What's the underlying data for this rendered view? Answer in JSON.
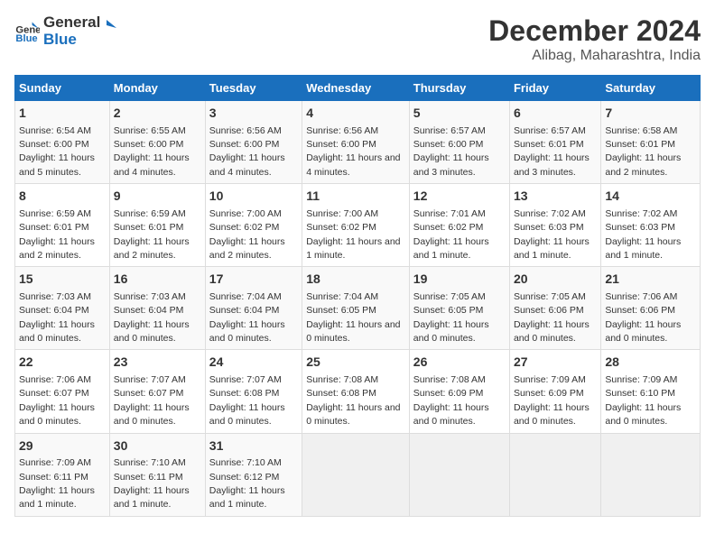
{
  "logo": {
    "line1": "General",
    "line2": "Blue"
  },
  "title": "December 2024",
  "subtitle": "Alibag, Maharashtra, India",
  "weekdays": [
    "Sunday",
    "Monday",
    "Tuesday",
    "Wednesday",
    "Thursday",
    "Friday",
    "Saturday"
  ],
  "weeks": [
    [
      {
        "day": "1",
        "sunrise": "6:54 AM",
        "sunset": "6:00 PM",
        "daylight": "11 hours and 5 minutes."
      },
      {
        "day": "2",
        "sunrise": "6:55 AM",
        "sunset": "6:00 PM",
        "daylight": "11 hours and 4 minutes."
      },
      {
        "day": "3",
        "sunrise": "6:56 AM",
        "sunset": "6:00 PM",
        "daylight": "11 hours and 4 minutes."
      },
      {
        "day": "4",
        "sunrise": "6:56 AM",
        "sunset": "6:00 PM",
        "daylight": "11 hours and 4 minutes."
      },
      {
        "day": "5",
        "sunrise": "6:57 AM",
        "sunset": "6:00 PM",
        "daylight": "11 hours and 3 minutes."
      },
      {
        "day": "6",
        "sunrise": "6:57 AM",
        "sunset": "6:01 PM",
        "daylight": "11 hours and 3 minutes."
      },
      {
        "day": "7",
        "sunrise": "6:58 AM",
        "sunset": "6:01 PM",
        "daylight": "11 hours and 2 minutes."
      }
    ],
    [
      {
        "day": "8",
        "sunrise": "6:59 AM",
        "sunset": "6:01 PM",
        "daylight": "11 hours and 2 minutes."
      },
      {
        "day": "9",
        "sunrise": "6:59 AM",
        "sunset": "6:01 PM",
        "daylight": "11 hours and 2 minutes."
      },
      {
        "day": "10",
        "sunrise": "7:00 AM",
        "sunset": "6:02 PM",
        "daylight": "11 hours and 2 minutes."
      },
      {
        "day": "11",
        "sunrise": "7:00 AM",
        "sunset": "6:02 PM",
        "daylight": "11 hours and 1 minute."
      },
      {
        "day": "12",
        "sunrise": "7:01 AM",
        "sunset": "6:02 PM",
        "daylight": "11 hours and 1 minute."
      },
      {
        "day": "13",
        "sunrise": "7:02 AM",
        "sunset": "6:03 PM",
        "daylight": "11 hours and 1 minute."
      },
      {
        "day": "14",
        "sunrise": "7:02 AM",
        "sunset": "6:03 PM",
        "daylight": "11 hours and 1 minute."
      }
    ],
    [
      {
        "day": "15",
        "sunrise": "7:03 AM",
        "sunset": "6:04 PM",
        "daylight": "11 hours and 0 minutes."
      },
      {
        "day": "16",
        "sunrise": "7:03 AM",
        "sunset": "6:04 PM",
        "daylight": "11 hours and 0 minutes."
      },
      {
        "day": "17",
        "sunrise": "7:04 AM",
        "sunset": "6:04 PM",
        "daylight": "11 hours and 0 minutes."
      },
      {
        "day": "18",
        "sunrise": "7:04 AM",
        "sunset": "6:05 PM",
        "daylight": "11 hours and 0 minutes."
      },
      {
        "day": "19",
        "sunrise": "7:05 AM",
        "sunset": "6:05 PM",
        "daylight": "11 hours and 0 minutes."
      },
      {
        "day": "20",
        "sunrise": "7:05 AM",
        "sunset": "6:06 PM",
        "daylight": "11 hours and 0 minutes."
      },
      {
        "day": "21",
        "sunrise": "7:06 AM",
        "sunset": "6:06 PM",
        "daylight": "11 hours and 0 minutes."
      }
    ],
    [
      {
        "day": "22",
        "sunrise": "7:06 AM",
        "sunset": "6:07 PM",
        "daylight": "11 hours and 0 minutes."
      },
      {
        "day": "23",
        "sunrise": "7:07 AM",
        "sunset": "6:07 PM",
        "daylight": "11 hours and 0 minutes."
      },
      {
        "day": "24",
        "sunrise": "7:07 AM",
        "sunset": "6:08 PM",
        "daylight": "11 hours and 0 minutes."
      },
      {
        "day": "25",
        "sunrise": "7:08 AM",
        "sunset": "6:08 PM",
        "daylight": "11 hours and 0 minutes."
      },
      {
        "day": "26",
        "sunrise": "7:08 AM",
        "sunset": "6:09 PM",
        "daylight": "11 hours and 0 minutes."
      },
      {
        "day": "27",
        "sunrise": "7:09 AM",
        "sunset": "6:09 PM",
        "daylight": "11 hours and 0 minutes."
      },
      {
        "day": "28",
        "sunrise": "7:09 AM",
        "sunset": "6:10 PM",
        "daylight": "11 hours and 0 minutes."
      }
    ],
    [
      {
        "day": "29",
        "sunrise": "7:09 AM",
        "sunset": "6:11 PM",
        "daylight": "11 hours and 1 minute."
      },
      {
        "day": "30",
        "sunrise": "7:10 AM",
        "sunset": "6:11 PM",
        "daylight": "11 hours and 1 minute."
      },
      {
        "day": "31",
        "sunrise": "7:10 AM",
        "sunset": "6:12 PM",
        "daylight": "11 hours and 1 minute."
      },
      null,
      null,
      null,
      null
    ]
  ]
}
